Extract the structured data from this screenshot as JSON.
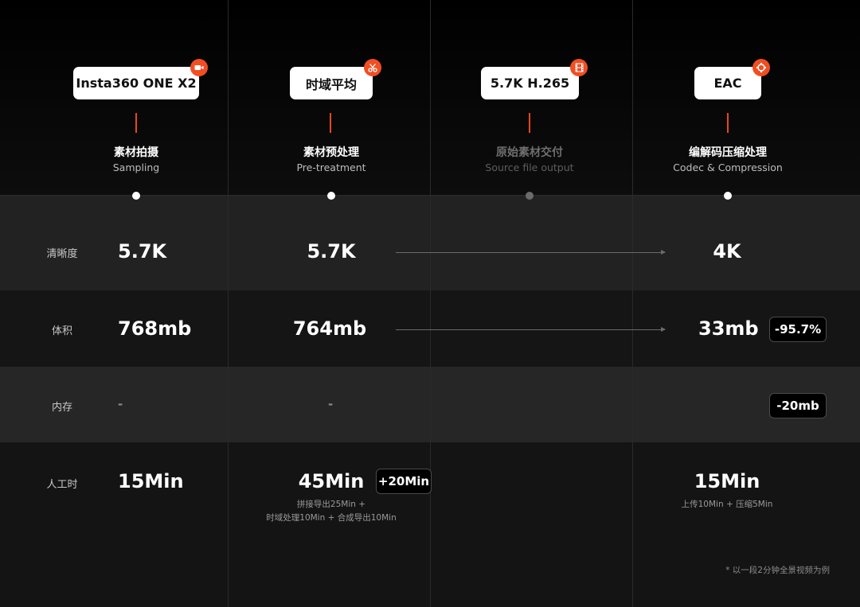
{
  "stages": [
    {
      "chip": "Insta360 ONE X2",
      "icon": "camera-icon",
      "title_cn": "素材拍摄",
      "title_en": "Sampling"
    },
    {
      "chip": "时域平均",
      "icon": "scissors-icon",
      "title_cn": "素材预处理",
      "title_en": "Pre-treatment"
    },
    {
      "chip": "5.7K H.265",
      "icon": "film-icon",
      "title_cn": "原始素材交付",
      "title_en": "Source file output"
    },
    {
      "chip": "EAC",
      "icon": "cube-icon",
      "title_cn": "编解码压缩处理",
      "title_en": "Codec & Compression"
    }
  ],
  "rows": {
    "clarity": {
      "label": "清晰度",
      "sampling": "5.7K",
      "pretreatment": "5.7K",
      "codec": "4K"
    },
    "size": {
      "label": "体积",
      "sampling": "768mb",
      "pretreatment": "764mb",
      "codec": "33mb",
      "codec_delta": "-95.7%"
    },
    "memory": {
      "label": "内存",
      "sampling": "-",
      "pretreatment": "-",
      "codec_delta": "-20mb"
    },
    "labor": {
      "label": "人工时",
      "sampling": "15Min",
      "pretreatment": "45Min",
      "pretreatment_delta": "+20Min",
      "pretreatment_note_1": "拼接导出25Min +",
      "pretreatment_note_2": "时域处理10Min + 合成导出10Min",
      "codec": "15Min",
      "codec_note": "上传10Min + 压缩5Min"
    }
  },
  "footnote": "* 以一段2分钟全景视频为例",
  "colors": {
    "accent": "#f04e23",
    "background": "#0b0b0b",
    "chip": "#ffffff"
  }
}
